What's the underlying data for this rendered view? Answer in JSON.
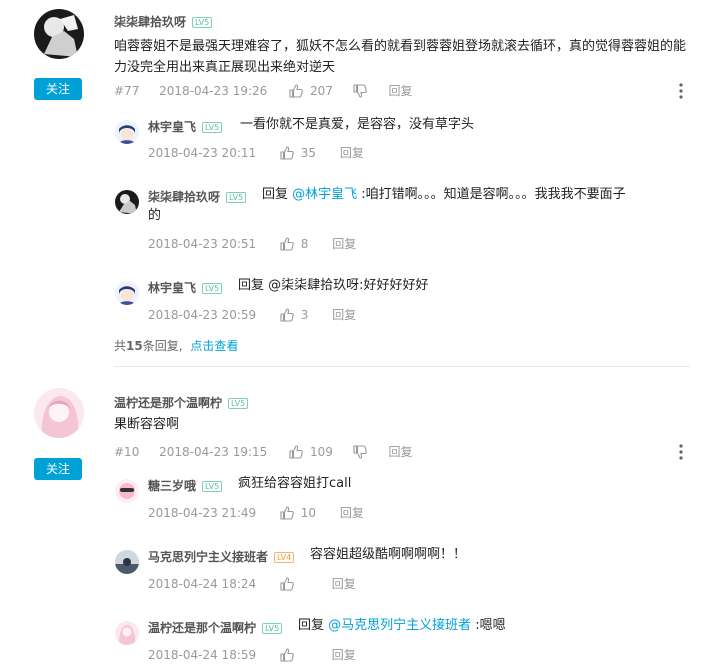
{
  "thread1": {
    "user": "柒柒肆拾玖呀",
    "level": "LV5",
    "follow_label": "关注",
    "content": "咱蓉蓉姐不是最强天理难容了，狐妖不怎么看的就看到蓉蓉姐登场就滚去循环，真的觉得蓉蓉姐的能力没完全用出来真正展现出来绝对逆天",
    "floor": "#77",
    "time": "2018-04-23 19:26",
    "likes": "207",
    "reply_label": "回复",
    "replies": [
      {
        "user": "林宇皇飞",
        "level": "LV5",
        "content": "一看你就不是真爱，是容容，没有草字头",
        "time": "2018-04-23 20:11",
        "likes": "35",
        "reply_label": "回复"
      },
      {
        "user": "柒柒肆拾玖呀",
        "level": "LV5",
        "prefix": "回复 ",
        "mention": "@林宇皇飞",
        "content_line1": " :咱打错啊。。。知道是容啊。。。我我我不要面子",
        "content_line2": "的",
        "time": "2018-04-23 20:51",
        "likes": "8",
        "reply_label": "回复"
      },
      {
        "user": "林宇皇飞",
        "level": "LV5",
        "content": "回复 @柒柒肆拾玖呀:好好好好好",
        "time": "2018-04-23 20:59",
        "likes": "3",
        "reply_label": "回复"
      }
    ],
    "summary_prefix": "共",
    "summary_count": "15",
    "summary_suffix": "条回复,",
    "summary_link": "点击查看"
  },
  "thread2": {
    "user": "温柠还是那个温啊柠",
    "level": "LV5",
    "follow_label": "关注",
    "content": "果断容容啊",
    "floor": "#10",
    "time": "2018-04-23 19:15",
    "likes": "109",
    "reply_label": "回复",
    "replies": [
      {
        "user": "糖三岁哦",
        "level": "LV5",
        "content": "疯狂给容容姐打call",
        "time": "2018-04-23 21:49",
        "likes": "10",
        "reply_label": "回复"
      },
      {
        "user": "马克思列宁主义接班者",
        "level": "LV4",
        "content": "容容姐超级酷啊啊啊啊！！",
        "time": "2018-04-24 18:24",
        "likes": "",
        "reply_label": "回复"
      },
      {
        "user": "温柠还是那个温啊柠",
        "level": "LV5",
        "prefix": "回复 ",
        "mention": "@马克思列宁主义接班者",
        "content_tail": " :嗯嗯",
        "time": "2018-04-24 18:59",
        "likes": "",
        "reply_label": "回复"
      }
    ]
  },
  "colors": {
    "accent": "#00a1d6",
    "muted": "#999999",
    "level_green": "#5cc29a"
  }
}
